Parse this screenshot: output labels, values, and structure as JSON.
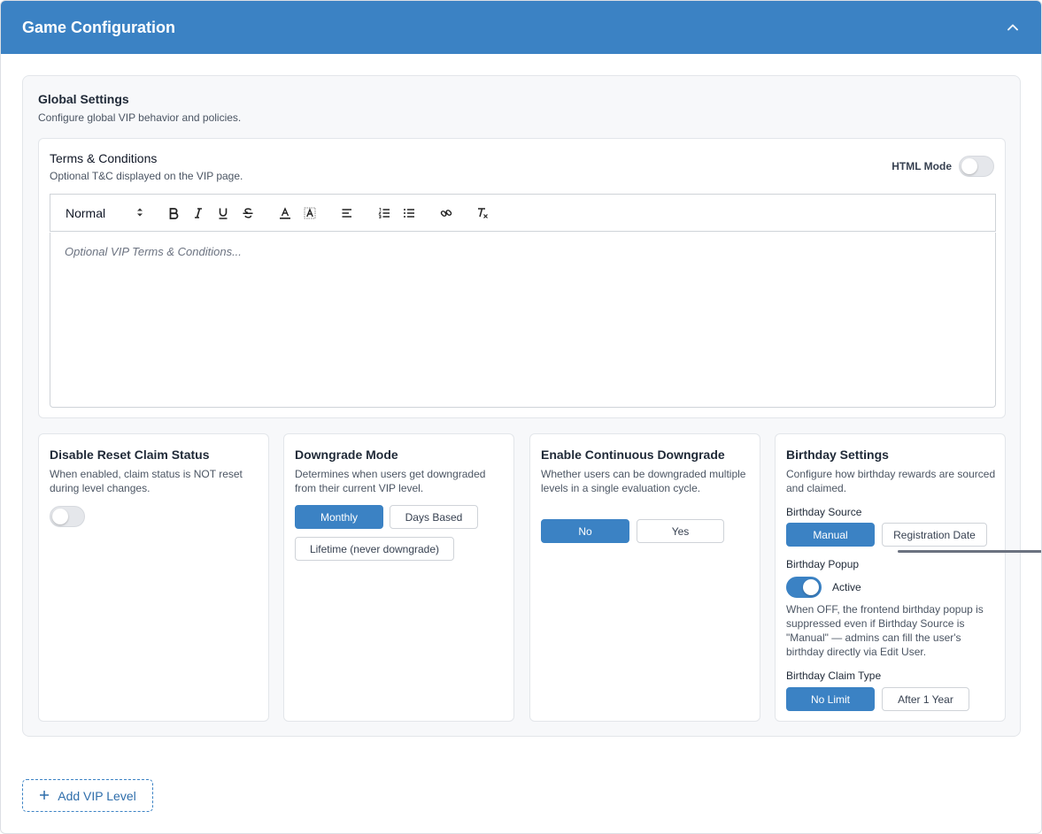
{
  "header": {
    "title": "Game Configuration"
  },
  "global": {
    "title": "Global Settings",
    "subtitle": "Configure global VIP behavior and policies."
  },
  "terms": {
    "title": "Terms & Conditions",
    "subtitle": "Optional T&C displayed on the VIP page.",
    "html_mode_label": "HTML Mode",
    "html_mode_on": false,
    "format_select": "Normal",
    "placeholder": "Optional VIP Terms & Conditions..."
  },
  "disable_reset": {
    "title": "Disable Reset Claim Status",
    "description": "When enabled, claim status is NOT reset during level changes.",
    "enabled": false
  },
  "downgrade_mode": {
    "title": "Downgrade Mode",
    "description": "Determines when users get downgraded from their current VIP level.",
    "options": [
      "Monthly",
      "Days Based",
      "Lifetime (never downgrade)"
    ],
    "selected": "Monthly"
  },
  "continuous_downgrade": {
    "title": "Enable Continuous Downgrade",
    "description": "Whether users can be downgraded multiple levels in a single evaluation cycle.",
    "options": [
      "No",
      "Yes"
    ],
    "selected": "No"
  },
  "birthday": {
    "title": "Birthday Settings",
    "description": "Configure how birthday rewards are sourced and claimed.",
    "source_label": "Birthday Source",
    "source_options": [
      "Manual",
      "Registration Date"
    ],
    "source_selected": "Manual",
    "popup_label": "Birthday Popup",
    "popup_state": "Active",
    "popup_on": true,
    "popup_note": "When OFF, the frontend birthday popup is suppressed even if Birthday Source is \"Manual\" — admins can fill the user's birthday directly via Edit User.",
    "claim_label": "Birthday Claim Type",
    "claim_options": [
      "No Limit",
      "After 1 Year"
    ],
    "claim_selected": "No Limit"
  },
  "add_level": {
    "label": "Add VIP Level"
  },
  "colors": {
    "accent": "#3b82c4",
    "panel_bg": "#f7f8fa"
  },
  "icons": [
    "chevron-up-icon",
    "plus-icon",
    "bold-icon",
    "italic-icon",
    "underline-icon",
    "strike-icon",
    "font-color-icon",
    "highlight-icon",
    "align-left-icon",
    "ordered-list-icon",
    "bullet-list-icon",
    "link-icon",
    "clear-format-icon"
  ]
}
